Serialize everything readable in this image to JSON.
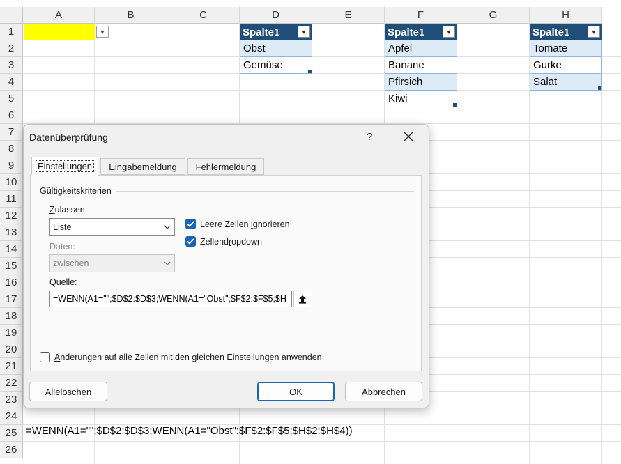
{
  "sheet": {
    "columns": [
      "A",
      "B",
      "C",
      "D",
      "E",
      "F",
      "G",
      "H"
    ],
    "rows": [
      "1",
      "2",
      "3",
      "4",
      "5",
      "6",
      "7",
      "8",
      "9",
      "10",
      "11",
      "12",
      "13",
      "14",
      "15",
      "16",
      "17",
      "18",
      "19",
      "20",
      "21",
      "22",
      "23",
      "24",
      "25",
      "26"
    ],
    "table_d": {
      "header": "Spalte1",
      "items": [
        "Obst",
        "Gemüse"
      ]
    },
    "table_f": {
      "header": "Spalte1",
      "items": [
        "Apfel",
        "Banane",
        "Pfirsich",
        "Kiwi"
      ]
    },
    "table_h": {
      "header": "Spalte1",
      "items": [
        "Tomate",
        "Gurke",
        "Salat"
      ]
    },
    "formula_a25": "=WENN(A1=\"\";$D$2:$D$3;WENN(A1=\"Obst\";$F$2:$F$5;$H$2:$H$4))",
    "colors": {
      "cell_a1": "#ffff00",
      "table_header": "#1f4e79",
      "table_band": "#ddebf7"
    }
  },
  "dialog": {
    "title": "Datenüberprüfung",
    "help": "?",
    "tabs": [
      "Einstellungen",
      "Eingabemeldung",
      "Fehlermeldung"
    ],
    "active_tab": "Einstellungen",
    "group_label": "Gültigkeitskriterien",
    "allow_label": {
      "pre": "",
      "acc": "Z",
      "post": "ulassen:"
    },
    "allow_value": "Liste",
    "data_label": "Daten:",
    "data_value": "zwischen",
    "ignore_blank": {
      "pre": "Leere Zellen ",
      "acc": "i",
      "post": "gnorieren",
      "checked": true
    },
    "in_cell_dropdown": {
      "pre": "Zellend",
      "acc": "r",
      "post": "opdown",
      "checked": true
    },
    "source_label": {
      "pre": "",
      "acc": "Q",
      "post": "uelle:"
    },
    "source_value": "=WENN(A1=\"\";$D$2:$D$3;WENN(A1=\"Obst\";$F$2:$F$5;$H",
    "apply_all": {
      "pre": "",
      "acc": "Ä",
      "post": "nderungen auf alle Zellen mit den gleichen Einstellungen anwenden",
      "checked": false
    },
    "clear_all": {
      "pre": "Alle ",
      "acc": "l",
      "post": "öschen"
    },
    "ok": "OK",
    "cancel": "Abbrechen",
    "accent": "#1a64b3"
  }
}
